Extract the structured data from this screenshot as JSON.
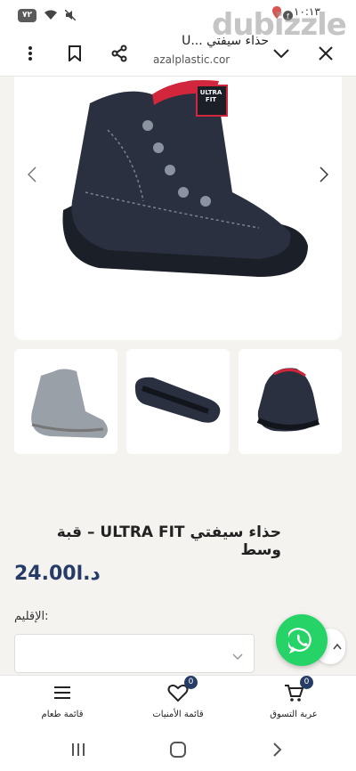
{
  "status_bar": {
    "time": "١٠:١٣",
    "battery": "٧٢",
    "icons": [
      "battery-icon",
      "wifi-icon",
      "mute-icon",
      "facebook-icon",
      "location-icon"
    ]
  },
  "browser": {
    "tab_title": "حذاء سيفتي ...U",
    "url": "azalplastic.cor",
    "icons": [
      "more-vert-icon",
      "bookmark-icon",
      "share-icon",
      "chevron-down-icon",
      "close-icon"
    ]
  },
  "watermark": "dubizzle",
  "product": {
    "main_badge_text": "ULTRA FIT",
    "title": "حذاء سيفتي ULTRA FIT – قبة وسط",
    "price": "د.ا24.00",
    "region_label": "الإقليم:",
    "region_selected": ""
  },
  "bottom_nav": {
    "items": [
      {
        "label": "قائمة طعام",
        "icon": "menu-icon"
      },
      {
        "label": "قائمة الأمنيات",
        "icon": "heart-icon",
        "badge": "0"
      },
      {
        "label": "عربة التسوق",
        "icon": "cart-icon",
        "badge": "0"
      }
    ]
  },
  "colors": {
    "accent": "#263b66",
    "whatsapp": "#25d366",
    "page_bg": "#f4f3ef"
  }
}
